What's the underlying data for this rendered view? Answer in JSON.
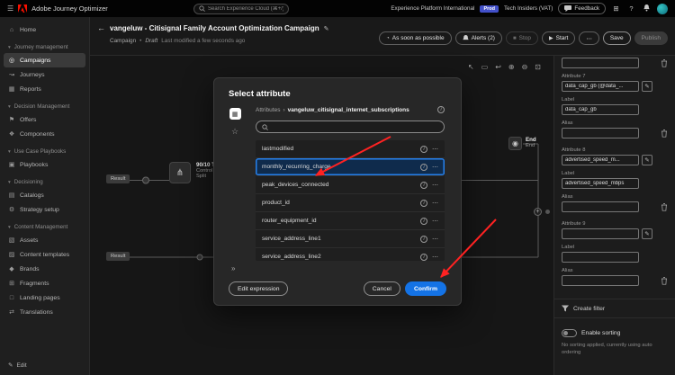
{
  "topbar": {
    "app_title": "Adobe Journey Optimizer",
    "search_placeholder": "Search Experience Cloud (⌘+/)",
    "org": "Experience Platform International",
    "env_badge": "Prod",
    "sandbox": "Tech Insiders (VAT)",
    "feedback_label": "Feedback"
  },
  "sidebar": {
    "items": [
      {
        "label": "Home"
      },
      {
        "label": "Journey management"
      },
      {
        "label": "Campaigns"
      },
      {
        "label": "Journeys"
      },
      {
        "label": "Reports"
      },
      {
        "label": "Decision Management"
      },
      {
        "label": "Offers"
      },
      {
        "label": "Components"
      },
      {
        "label": "Use Case Playbooks"
      },
      {
        "label": "Playbooks"
      },
      {
        "label": "Decisioning"
      },
      {
        "label": "Catalogs"
      },
      {
        "label": "Strategy setup"
      },
      {
        "label": "Content Management"
      },
      {
        "label": "Assets"
      },
      {
        "label": "Content templates"
      },
      {
        "label": "Brands"
      },
      {
        "label": "Fragments"
      },
      {
        "label": "Landing pages"
      },
      {
        "label": "Translations"
      }
    ],
    "edit_label": "Edit"
  },
  "header": {
    "title": "vangeluw - Citisignal Family Account Optimization Campaign",
    "type_label": "Campaign",
    "status": "Draft",
    "last_modified": "Last modified a few seconds ago",
    "schedule_label": "As soon as possible",
    "alerts_label": "Alerts (2)",
    "stop_label": "Stop",
    "start_label": "Start",
    "save_label": "Save",
    "publish_label": "Publish"
  },
  "canvas": {
    "result_1": "Result",
    "result_2": "Result",
    "split_node": {
      "title": "90/10 Treat...",
      "line2": "Control",
      "line3": "Split"
    },
    "end_title": "End",
    "end_type": "End"
  },
  "modal": {
    "title": "Select attribute",
    "breadcrumb_root": "Attributes",
    "breadcrumb_current": "vangeluw_citisignal_internet_subscriptions",
    "rows": [
      "lastmodified",
      "monthly_recurring_charge",
      "peak_devices_connected",
      "product_id",
      "router_equipment_id",
      "service_address_line1",
      "service_address_line2"
    ],
    "selected_row": "monthly_recurring_charge",
    "edit_expression_label": "Edit expression",
    "cancel_label": "Cancel",
    "confirm_label": "Confirm"
  },
  "right_panel": {
    "label_caption": "Label",
    "alias_caption": "Alias",
    "attributes": [
      {
        "title": "Attribute 7",
        "value": "data_cap_gb (@data_...",
        "label_value": "data_cap_gb",
        "alias_value": ""
      },
      {
        "title": "Attribute 8",
        "value": "advertised_speed_m...",
        "label_value": "advertised_speed_mbps",
        "alias_value": ""
      },
      {
        "title": "Attribute 9",
        "value": "",
        "label_value": "",
        "alias_value": ""
      }
    ],
    "create_filter_label": "Create filter",
    "enable_sorting_label": "Enable sorting",
    "sorting_note": "No sorting applied, currently using auto ordering"
  },
  "colors": {
    "accent_blue": "#1473e6",
    "selection_blue": "#2680eb",
    "annotation_red": "#ff2222",
    "prod_badge": "#4250c9"
  },
  "icons": {
    "hamburger": "☰",
    "home": "⌂",
    "chevron_down": "▾",
    "campaigns": "◎",
    "journeys": "↝",
    "reports": "▦",
    "offers": "⚑",
    "components": "❖",
    "playbooks": "▣",
    "catalogs": "▤",
    "strategy_setup": "⚙",
    "assets": "▧",
    "content_templates": "▨",
    "brands": "◆",
    "fragments": "⊞",
    "landing_pages": "□",
    "translations": "⇄",
    "edit_pencil": "✎",
    "back_arrow": "←",
    "bullet": "•",
    "clock": "◔",
    "stop": "■",
    "play": "▶",
    "more": "⋯",
    "pointer": "↖",
    "marquee": "▭",
    "undo": "↩",
    "zoom_in": "⊕",
    "zoom_out": "⊖",
    "fit": "⊡",
    "breadcrumb_sep": "›",
    "star": "☆",
    "info": "i",
    "row_more": "⋯",
    "collapse": "»",
    "help": "?",
    "apps": "⊞",
    "plus": "+",
    "split": "⋔",
    "end_node": "◉",
    "attribute_picker": "✎",
    "grid": "▦"
  }
}
